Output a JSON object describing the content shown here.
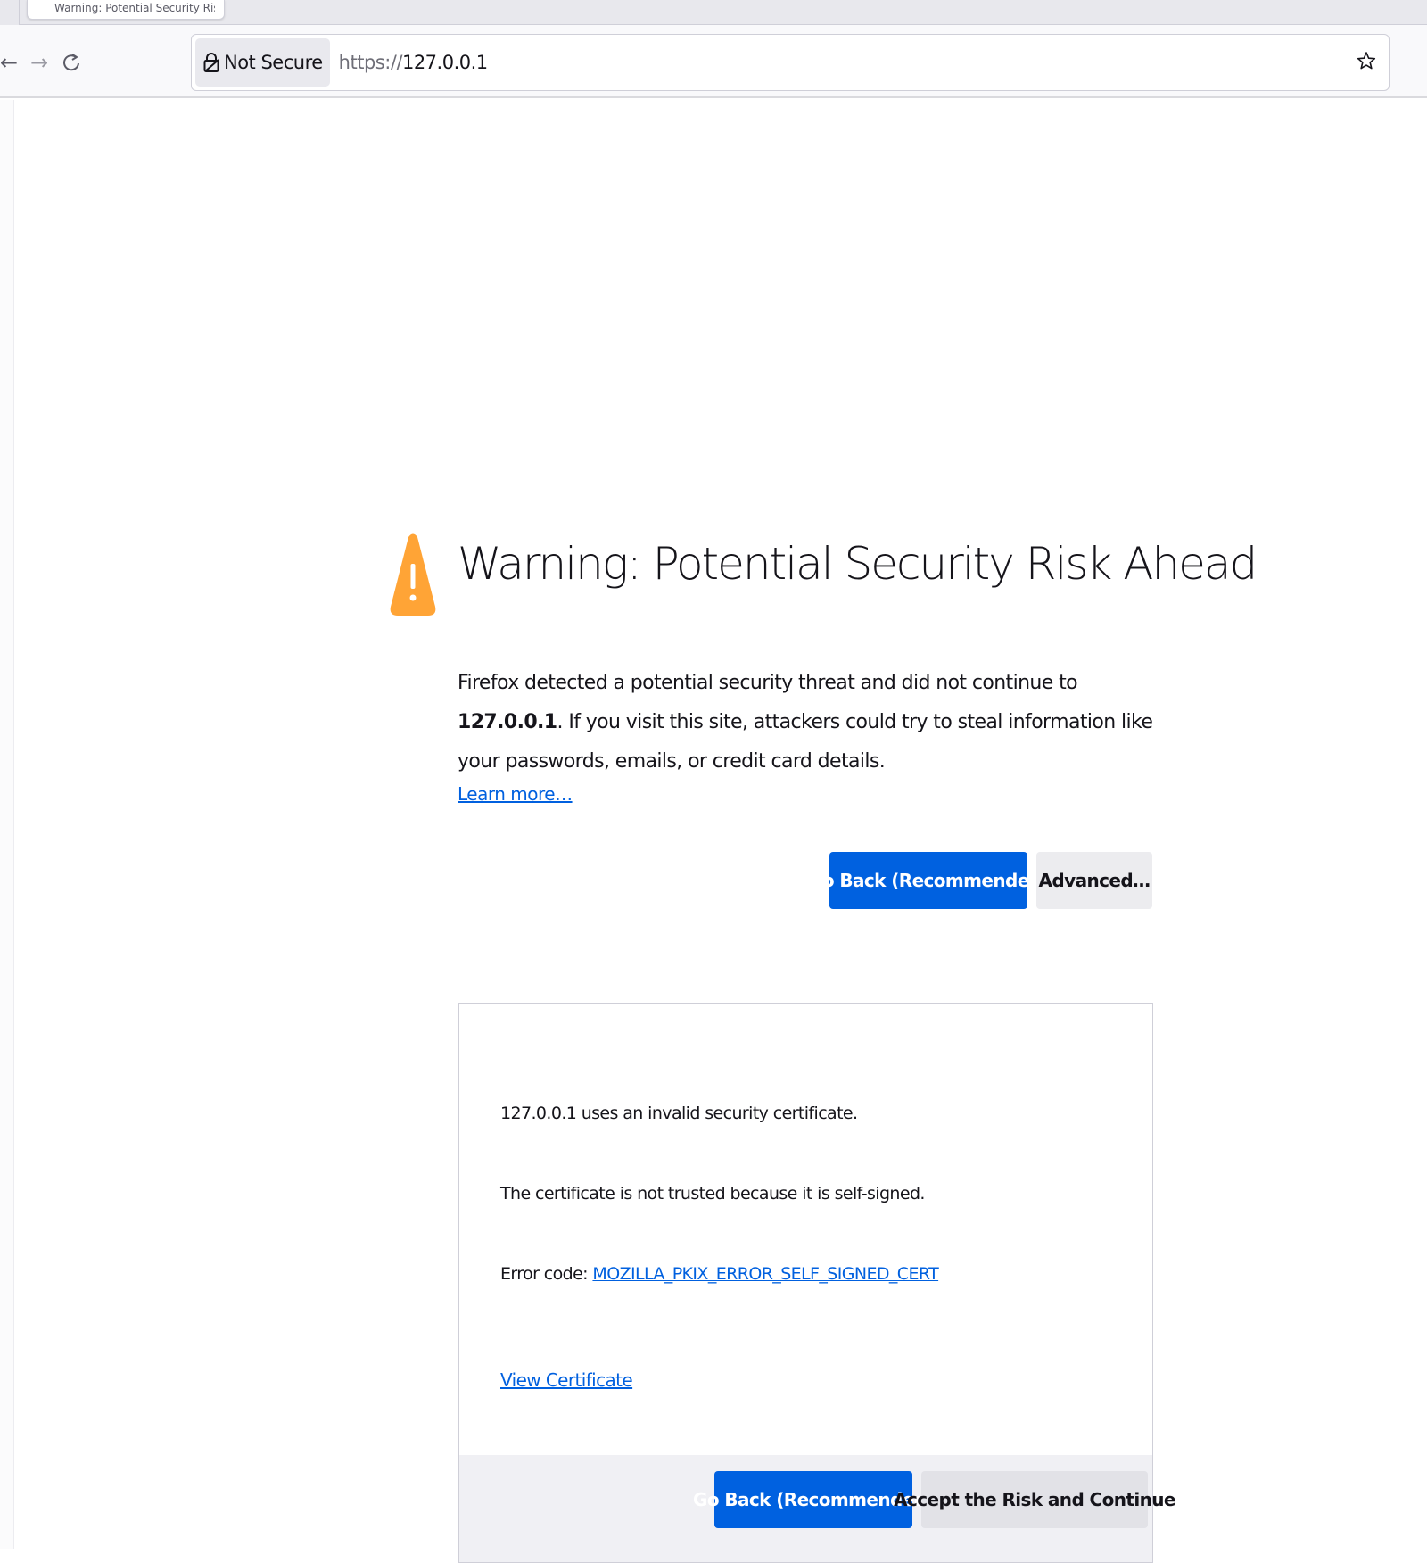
{
  "browser": {
    "tab_title": "Warning: Potential Security Risk Ahead",
    "identity_label": "Not Secure",
    "url_scheme": "https://",
    "url_host": "127.0.0.1",
    "nav_icons": {
      "back": "arrow-left-icon",
      "forward": "arrow-right-icon",
      "reload": "reload-icon",
      "bookmark": "star-icon",
      "identity": "insecure-lock-icon"
    }
  },
  "page": {
    "title": "Warning: Potential Security Risk Ahead",
    "intro_before": "Firefox detected a potential security threat and did not continue to ",
    "intro_host": "127.0.0.1",
    "intro_after": ". If you visit this site, attackers could try to steal information like your passwords, emails, or credit card details.",
    "learn_more": "Learn more…",
    "go_back_label": "Go Back (Recommended)",
    "advanced_label": "Advanced…",
    "warning_icon": "warning-triangle-icon"
  },
  "advanced": {
    "line1": "127.0.0.1 uses an invalid security certificate.",
    "line2": "The certificate is not trusted because it is self-signed.",
    "error_code_prefix": "Error code: ",
    "error_code": "MOZILLA_PKIX_ERROR_SELF_SIGNED_CERT",
    "view_certificate": "View Certificate",
    "go_back_label": "Go Back (Recommended)",
    "accept_label": "Accept the Risk and Continue"
  },
  "colors": {
    "primary_button": "#0061e0",
    "link": "#0060df",
    "warning": "#ffa436",
    "secondary_button": "#ececef"
  }
}
